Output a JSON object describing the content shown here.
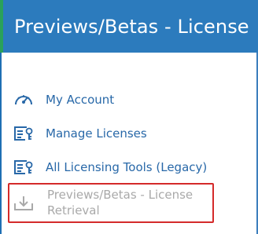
{
  "header": {
    "title": "Previews/Betas - License"
  },
  "nav": {
    "items": [
      {
        "label": "My Account",
        "icon": "dashboard-gauge-icon"
      },
      {
        "label": "Manage Licenses",
        "icon": "license-certificate-icon"
      },
      {
        "label": "All Licensing Tools (Legacy)",
        "icon": "license-certificate-icon"
      },
      {
        "label_line1": "Previews/Betas - License",
        "label_line2": "Retrieval",
        "icon": "download-tray-icon",
        "state": "active/disabled"
      }
    ]
  },
  "colors": {
    "header_bg": "#2c7bbd",
    "accent_green": "#2aa15a",
    "link_blue": "#2868a8",
    "disabled_gray": "#a9a9a9",
    "highlight_red": "#d42a2a"
  }
}
